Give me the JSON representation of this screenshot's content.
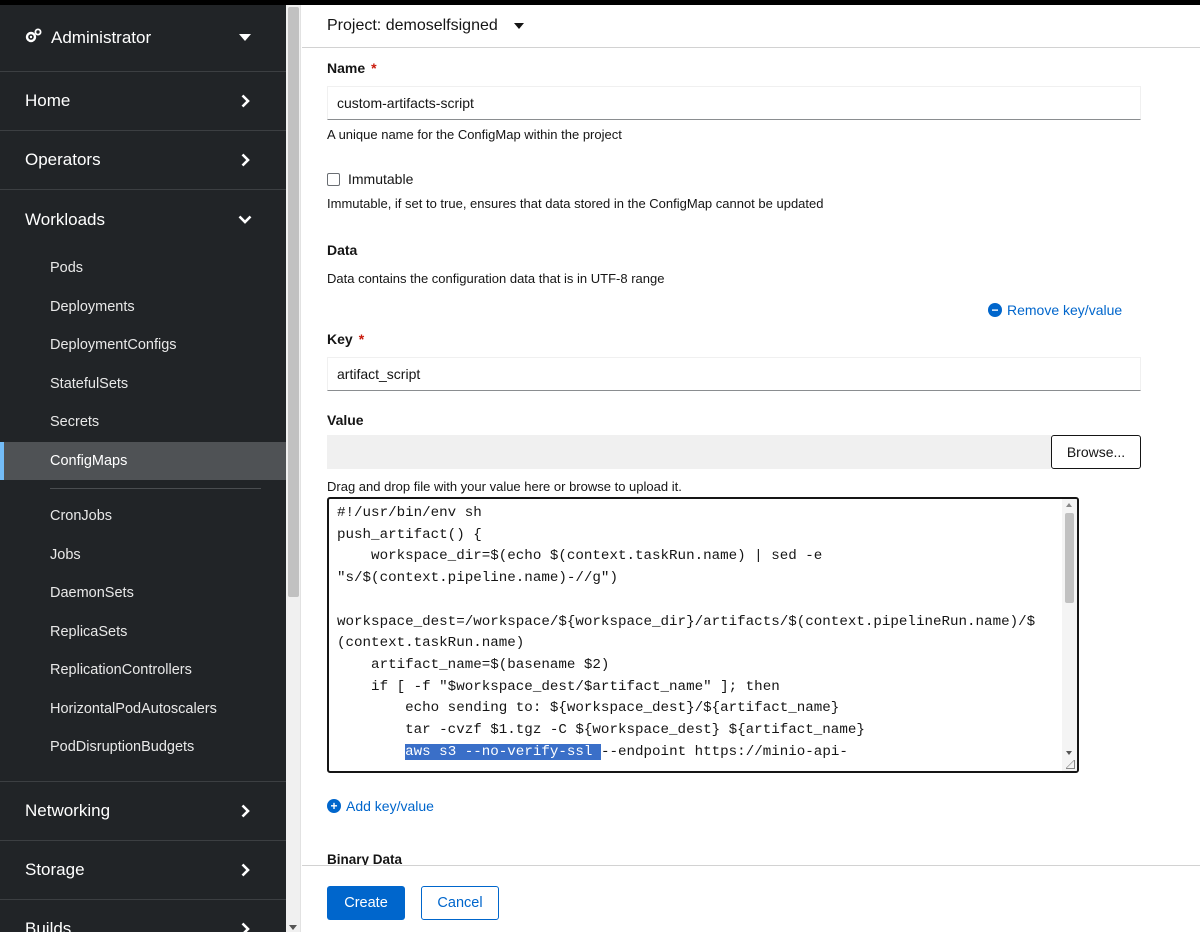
{
  "sidebar": {
    "perspective": {
      "label": "Administrator",
      "icon": "cogs-icon"
    },
    "sections_top": [
      {
        "key": "home",
        "label": "Home"
      },
      {
        "key": "operators",
        "label": "Operators"
      }
    ],
    "workloads": {
      "label": "Workloads",
      "items": [
        "Pods",
        "Deployments",
        "DeploymentConfigs",
        "StatefulSets",
        "Secrets",
        "ConfigMaps"
      ],
      "items_after": [
        "CronJobs",
        "Jobs",
        "DaemonSets",
        "ReplicaSets",
        "ReplicationControllers",
        "HorizontalPodAutoscalers",
        "PodDisruptionBudgets"
      ],
      "active": "ConfigMaps"
    },
    "sections_bottom": [
      {
        "key": "networking",
        "label": "Networking"
      },
      {
        "key": "storage",
        "label": "Storage"
      },
      {
        "key": "builds",
        "label": "Builds"
      }
    ]
  },
  "project": {
    "label": "Project: demoselfsigned"
  },
  "form": {
    "name": {
      "label": "Name",
      "required_mark": "*",
      "value": "custom-artifacts-script",
      "helper": "A unique name for the ConfigMap within the project"
    },
    "immutable": {
      "label": "Immutable",
      "checked": false,
      "helper": "Immutable, if set to true, ensures that data stored in the ConfigMap cannot be updated"
    },
    "data": {
      "heading": "Data",
      "helper": "Data contains the configuration data that is in UTF-8 range",
      "remove_link": "Remove key/value"
    },
    "key": {
      "label": "Key",
      "required_mark": "*",
      "value": "artifact_script"
    },
    "value": {
      "label": "Value",
      "browse_label": "Browse...",
      "helper": "Drag and drop file with your value here or browse to upload it.",
      "code_lines": [
        "#!/usr/bin/env sh",
        "push_artifact() {",
        "    workspace_dir=$(echo $(context.taskRun.name) | sed -e",
        "\"s/$(context.pipeline.name)-//g\")",
        "",
        "workspace_dest=/workspace/${workspace_dir}/artifacts/$(context.pipelineRun.name)/$",
        "(context.taskRun.name)",
        "    artifact_name=$(basename $2)",
        "    if [ -f \"$workspace_dest/$artifact_name\" ]; then",
        "        echo sending to: ${workspace_dest}/${artifact_name}",
        "        tar -cvzf $1.tgz -C ${workspace_dest} ${artifact_name}"
      ],
      "code_selected_indent": "        ",
      "code_selected": "aws s3 --no-verify-ssl ",
      "code_after_selected": "--endpoint https://minio-api-"
    },
    "add_link": "Add key/value",
    "binary_heading": "Binary Data"
  },
  "footer": {
    "create_label": "Create",
    "cancel_label": "Cancel"
  }
}
